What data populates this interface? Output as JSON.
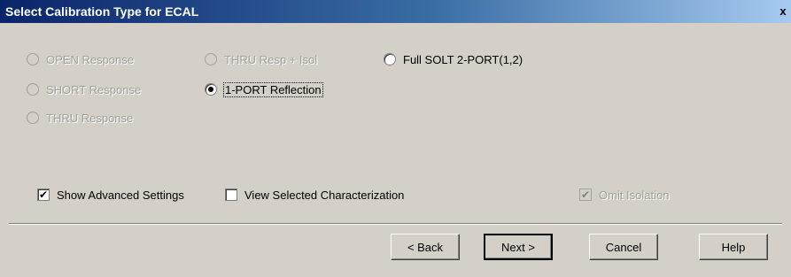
{
  "window": {
    "title": "Select Calibration Type for ECAL",
    "close_glyph": "x"
  },
  "options": {
    "open_response": "OPEN Response",
    "short_response": "SHORT Response",
    "thru_response": "THRU Response",
    "thru_resp_isol": "THRU Resp + Isol",
    "one_port_reflection": "1-PORT Reflection",
    "full_solt": "Full SOLT 2-PORT(1,2)"
  },
  "checkboxes": {
    "show_advanced": {
      "label": "Show Advanced Settings",
      "checked": true
    },
    "view_selected": {
      "label": "View Selected Characterization",
      "checked": false
    },
    "omit_isolation": {
      "label": "Omit Isolation",
      "checked": true
    }
  },
  "buttons": {
    "back": "< Back",
    "next": "Next >",
    "cancel": "Cancel",
    "help": "Help"
  },
  "colors": {
    "titlebar_start": "#0a246a",
    "titlebar_end": "#a6caf0",
    "dialog_bg": "#d4d0c8",
    "disabled_text": "#a19f99"
  }
}
